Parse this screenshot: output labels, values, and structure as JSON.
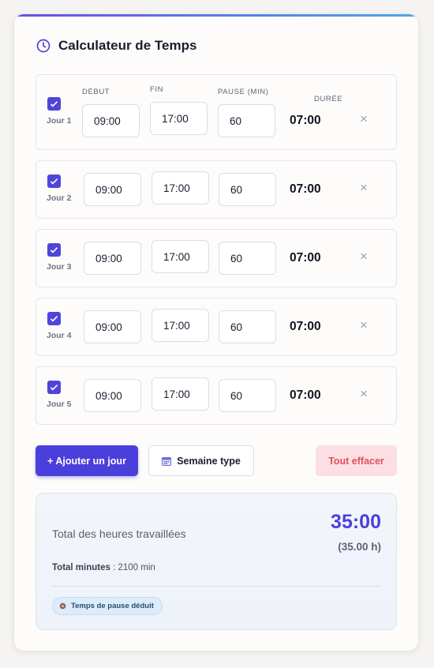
{
  "header": {
    "title": "Calculateur de Temps",
    "icon": "clock-icon",
    "accent": "#4b3fdc"
  },
  "columns": {
    "start": "DÉBUT",
    "end": "FIN",
    "pause": "PAUSE (MIN)",
    "duration": "DURÉE"
  },
  "days": [
    {
      "label": "Jour 1",
      "checked": true,
      "start": "09:00",
      "end": "17:00",
      "pause": "60",
      "duration": "07:00"
    },
    {
      "label": "Jour 2",
      "checked": true,
      "start": "09:00",
      "end": "17:00",
      "pause": "60",
      "duration": "07:00"
    },
    {
      "label": "Jour 3",
      "checked": true,
      "start": "09:00",
      "end": "17:00",
      "pause": "60",
      "duration": "07:00"
    },
    {
      "label": "Jour 4",
      "checked": true,
      "start": "09:00",
      "end": "17:00",
      "pause": "60",
      "duration": "07:00"
    },
    {
      "label": "Jour 5",
      "checked": true,
      "start": "09:00",
      "end": "17:00",
      "pause": "60",
      "duration": "07:00"
    }
  ],
  "remove_glyph": "×",
  "actions": {
    "add": "+ Ajouter un jour",
    "week": "Semaine type",
    "clear": "Tout effacer"
  },
  "summary": {
    "label": "Total des heures travaillées",
    "total": "35:00",
    "hours": "(35.00 h)",
    "minutes_label": "Total minutes",
    "minutes_value": ": 2100 min",
    "badge": "Temps de pause déduit"
  }
}
